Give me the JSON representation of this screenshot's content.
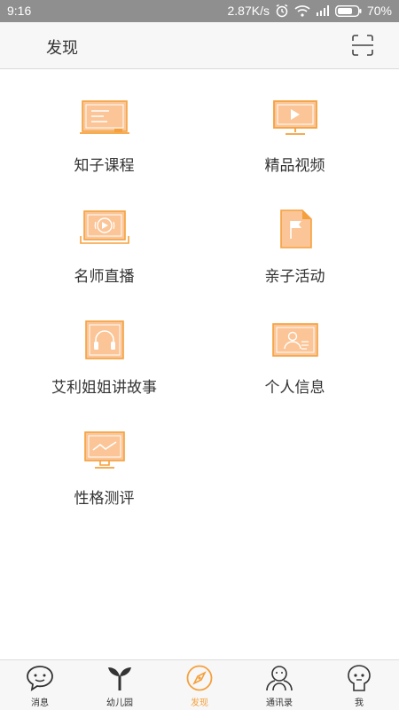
{
  "status_bar": {
    "time": "9:16",
    "network_speed": "2.87K/s",
    "battery": "70%",
    "icons": [
      "alarm-icon",
      "wifi-icon",
      "signal-icon",
      "battery-icon"
    ]
  },
  "header": {
    "title": "发现",
    "scan_icon": "scan-icon"
  },
  "colors": {
    "accent": "#f5a03c",
    "icon_fill": "#fbc597",
    "text": "#333333"
  },
  "grid": {
    "items": [
      {
        "label": "知子课程",
        "icon": "course-board-icon"
      },
      {
        "label": "精品视频",
        "icon": "video-monitor-icon"
      },
      {
        "label": "名师直播",
        "icon": "live-broadcast-icon"
      },
      {
        "label": "亲子活动",
        "icon": "flag-document-icon"
      },
      {
        "label": "艾利姐姐讲故事",
        "icon": "headphones-icon"
      },
      {
        "label": "个人信息",
        "icon": "profile-card-icon"
      },
      {
        "label": "性格测评",
        "icon": "chart-monitor-icon"
      }
    ]
  },
  "tab_bar": {
    "tabs": [
      {
        "label": "消息",
        "icon": "chat-bubble-icon",
        "active": false
      },
      {
        "label": "幼儿园",
        "icon": "sprout-icon",
        "active": false
      },
      {
        "label": "发现",
        "icon": "compass-icon",
        "active": true
      },
      {
        "label": "通讯录",
        "icon": "contacts-icon",
        "active": false
      },
      {
        "label": "我",
        "icon": "me-face-icon",
        "active": false
      }
    ]
  }
}
